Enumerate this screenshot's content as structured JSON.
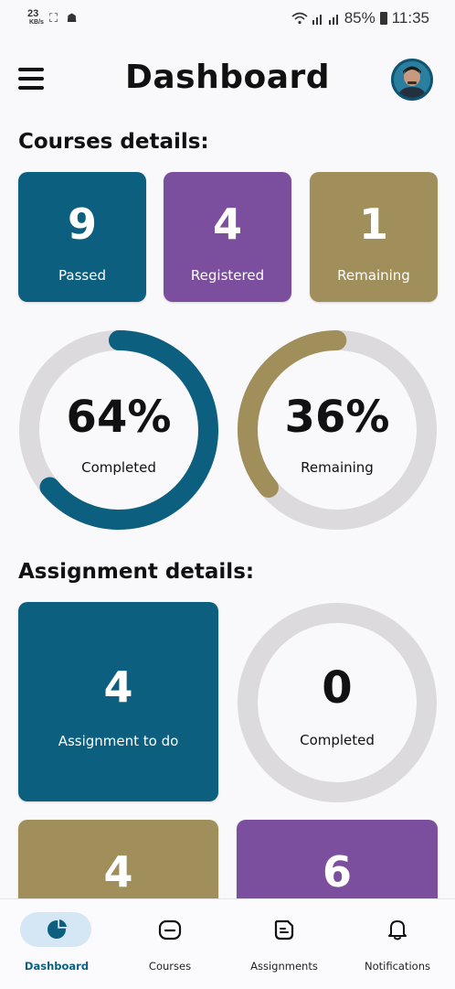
{
  "status_bar": {
    "data_rate": "23",
    "data_unit": "KB/s",
    "battery": "85%",
    "time": "11:35"
  },
  "header": {
    "title": "Dashboard"
  },
  "courses": {
    "section_title": "Courses details:",
    "cards": [
      {
        "value": "9",
        "label": "Passed",
        "color": "#0c5f7e"
      },
      {
        "value": "4",
        "label": "Registered",
        "color": "#7b4f9e"
      },
      {
        "value": "1",
        "label": "Remaining",
        "color": "#a08f5b"
      }
    ],
    "rings": [
      {
        "value": "64%",
        "label": "Completed",
        "progress": 0.64,
        "color": "#0c5f7e"
      },
      {
        "value": "36%",
        "label": "Remaining",
        "progress": 0.36,
        "color": "#a08f5b"
      }
    ]
  },
  "assignments": {
    "section_title": "Assignment details:",
    "todo": {
      "value": "4",
      "label": "Assignment to do",
      "color": "#0c5f7e"
    },
    "completed": {
      "value": "0",
      "label": "Completed",
      "progress": 0
    },
    "bottom_cards": [
      {
        "value": "4",
        "color": "#a08f5b"
      },
      {
        "value": "6",
        "color": "#7b4f9e"
      }
    ]
  },
  "bottom_nav": {
    "items": [
      {
        "label": "Dashboard",
        "icon": "pie-chart-icon",
        "active": true
      },
      {
        "label": "Courses",
        "icon": "courses-icon",
        "active": false
      },
      {
        "label": "Assignments",
        "icon": "assignments-icon",
        "active": false
      },
      {
        "label": "Notifications",
        "icon": "bell-icon",
        "active": false
      }
    ]
  },
  "colors": {
    "teal": "#0c5f7e",
    "purple": "#7b4f9e",
    "olive": "#a08f5b",
    "ring_track": "#dcdadd",
    "nav_active_bg": "#d5e7f5"
  }
}
